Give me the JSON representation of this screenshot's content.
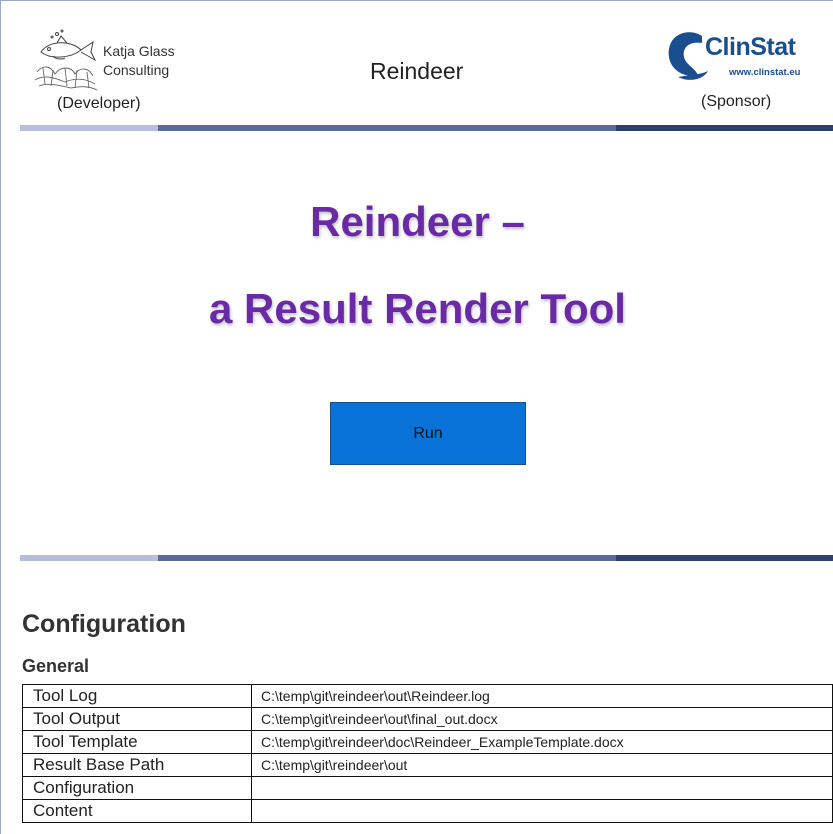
{
  "header": {
    "developer_name_line1": "Katja Glass",
    "developer_name_line2": "Consulting",
    "developer_role": "(Developer)",
    "title": "Reindeer",
    "sponsor_brand": "ClinStat",
    "sponsor_url": "www.clinstat.eu",
    "sponsor_role": "(Sponsor)"
  },
  "main": {
    "title_line1": "Reindeer –",
    "title_line2": "a Result Render Tool",
    "run_label": "Run"
  },
  "config": {
    "heading": "Configuration",
    "general_heading": "General",
    "rows": [
      {
        "key": "Tool Log",
        "value": "C:\\temp\\git\\reindeer\\out\\Reindeer.log"
      },
      {
        "key": "Tool Output",
        "value": "C:\\temp\\git\\reindeer\\out\\final_out.docx"
      },
      {
        "key": "Tool Template",
        "value": "C:\\temp\\git\\reindeer\\doc\\Reindeer_ExampleTemplate.docx"
      },
      {
        "key": "Result Base Path",
        "value": "C:\\temp\\git\\reindeer\\out"
      },
      {
        "key": "Configuration",
        "value": ""
      },
      {
        "key": "Content",
        "value": ""
      }
    ]
  },
  "colors": {
    "title_purple": "#6a2aa5",
    "run_button_blue": "#0a73d9",
    "brand_blue": "#1a4f8f",
    "rule_light": "#b6bedc",
    "rule_mid": "#5d6a9c",
    "rule_dark": "#2f3f70"
  },
  "icons": {
    "developer_logo": "fish-logo-icon",
    "sponsor_logo": "clinstat-logo-icon"
  }
}
